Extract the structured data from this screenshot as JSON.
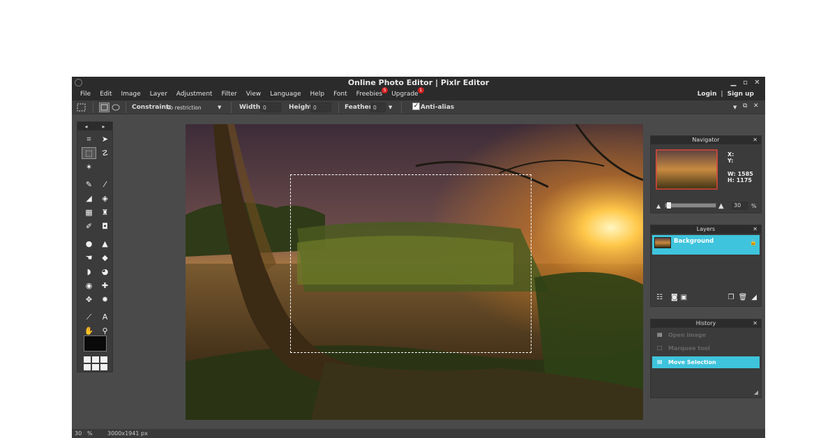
{
  "window": {
    "title": "Online Photo Editor | Pixlr Editor",
    "controls": [
      "▁",
      "▫",
      "✕"
    ]
  },
  "menu": {
    "items": [
      {
        "label": "File"
      },
      {
        "label": "Edit"
      },
      {
        "label": "Image"
      },
      {
        "label": "Layer"
      },
      {
        "label": "Adjustment"
      },
      {
        "label": "Filter"
      },
      {
        "label": "View"
      },
      {
        "label": "Language"
      },
      {
        "label": "Help"
      },
      {
        "label": "Font"
      },
      {
        "label": "Freebies",
        "badge": "5"
      },
      {
        "label": "Upgrade",
        "badge": "1"
      }
    ],
    "login": "Login",
    "separator": "|",
    "signup": "Sign up"
  },
  "options": {
    "constraint_label": "Constraint:",
    "constraint_value": "No restriction",
    "width_label": "Width:",
    "width_value": "0",
    "height_label": "Height:",
    "height_value": "0",
    "feather_label": "Feather:",
    "feather_value": "0",
    "antialias_label": "Anti-alias",
    "antialias_checked": true
  },
  "toolbox": {
    "prev": "◂",
    "next": "▸",
    "tools": [
      {
        "name": "crop-tool-icon",
        "glyph": "⌗"
      },
      {
        "name": "move-tool-icon",
        "glyph": "➤"
      },
      {
        "name": "marquee-tool-icon",
        "glyph": "⬚",
        "selected": true
      },
      {
        "name": "lasso-tool-icon",
        "glyph": "☡"
      },
      {
        "name": "wand-tool-icon",
        "glyph": "✶"
      },
      {
        "name": "empty",
        "glyph": ""
      },
      {
        "name": "pencil-tool-icon",
        "glyph": "✎"
      },
      {
        "name": "brush-tool-icon",
        "glyph": "⁄"
      },
      {
        "name": "eraser-tool-icon",
        "glyph": "◢"
      },
      {
        "name": "bucket-tool-icon",
        "glyph": "◈"
      },
      {
        "name": "gradient-tool-icon",
        "glyph": "▦"
      },
      {
        "name": "stamp-tool-icon",
        "glyph": "♜"
      },
      {
        "name": "color-replace-tool-icon",
        "glyph": "✐"
      },
      {
        "name": "drawing-tool-icon",
        "glyph": "◘"
      },
      {
        "name": "blur-tool-icon",
        "glyph": "●"
      },
      {
        "name": "sharpen-tool-icon",
        "glyph": "▲"
      },
      {
        "name": "smudge-tool-icon",
        "glyph": "☚"
      },
      {
        "name": "sponge-tool-icon",
        "glyph": "◆"
      },
      {
        "name": "burn-tool-icon",
        "glyph": "◗"
      },
      {
        "name": "dodge-tool-icon",
        "glyph": "◕"
      },
      {
        "name": "redeye-tool-icon",
        "glyph": "◉"
      },
      {
        "name": "spot-heal-tool-icon",
        "glyph": "✚"
      },
      {
        "name": "bloat-tool-icon",
        "glyph": "✥"
      },
      {
        "name": "pinch-tool-icon",
        "glyph": "✹"
      },
      {
        "name": "eyedropper-tool-icon",
        "glyph": "⟋"
      },
      {
        "name": "text-tool-icon",
        "glyph": "A"
      },
      {
        "name": "hand-tool-icon",
        "glyph": "✋"
      },
      {
        "name": "zoom-tool-icon",
        "glyph": "⚲"
      }
    ],
    "foreground_color": "#0a0a0a"
  },
  "navigator": {
    "title": "Navigator",
    "x_label": "X:",
    "y_label": "Y:",
    "w_label": "W:",
    "w_value": "1585",
    "h_label": "H:",
    "h_value": "1175",
    "zoom_value": "30",
    "zoom_unit": "%",
    "zoom_fraction": 0.03
  },
  "layers": {
    "title": "Layers",
    "items": [
      {
        "label": "Background",
        "locked": true
      }
    ]
  },
  "history": {
    "title": "History",
    "items": [
      {
        "label": "Open image",
        "active": false
      },
      {
        "label": "Marquee tool",
        "active": false
      },
      {
        "label": "Move Selection",
        "active": true
      }
    ]
  },
  "status": {
    "zoom": "30",
    "unit": "%",
    "dimensions": "3000x1941 px"
  },
  "colors": {
    "accent": "#3ec4dc",
    "chrome": "#2b2b2b",
    "workspace": "#4a4a4a",
    "panel": "#3b3b3b"
  }
}
